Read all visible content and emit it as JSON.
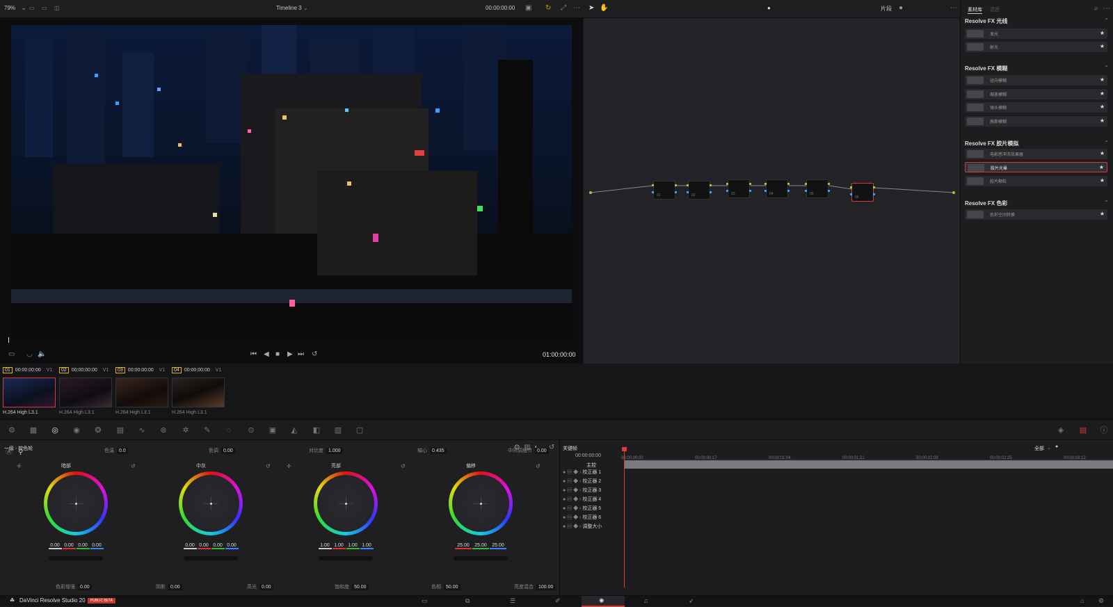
{
  "topbar": {
    "zoom": "79%",
    "timeline_name": "Timeline 3",
    "timecode": "00:00:00:00",
    "mode_label": "片段",
    "library_tab": "素材库",
    "library_tab2": "混音"
  },
  "viewer": {
    "timecode": "01:00:00:00"
  },
  "library": {
    "sections": [
      {
        "title": "Resolve FX 光线",
        "items": [
          "发光",
          "射光"
        ]
      },
      {
        "title": "Resolve FX 模糊",
        "items": [
          "径向模糊",
          "缩放模糊",
          "镜头模糊",
          "高斯模糊"
        ]
      },
      {
        "title": "Resolve FX 胶片模拟",
        "items": [
          "电影感冲洗效果器",
          "胶片光晕",
          "胶片颗粒"
        ]
      },
      {
        "title": "Resolve FX 色彩",
        "items": [
          "色彩空间转换"
        ]
      }
    ],
    "selected_item": "胶片光晕"
  },
  "nodes": [
    {
      "label": "01"
    },
    {
      "label": "02"
    },
    {
      "label": "03"
    },
    {
      "label": "04"
    },
    {
      "label": "05"
    },
    {
      "label": "06"
    }
  ],
  "clips": [
    {
      "num": "01",
      "timecode": "00:00:00:00",
      "track": "V1",
      "name": "H.264 High L3.1"
    },
    {
      "num": "02",
      "timecode": "00:00:00:00",
      "track": "V1",
      "name": "H.264 High L3.1"
    },
    {
      "num": "03",
      "timecode": "00:00:00:00",
      "track": "V1",
      "name": "H.264 High L3.1"
    },
    {
      "num": "04",
      "timecode": "00:00:00:00",
      "track": "V1",
      "name": "H.264 High L3.1"
    }
  ],
  "primaries": {
    "title": "一级 - 校色轮",
    "params_top": [
      {
        "label": "色温",
        "value": "0.0"
      },
      {
        "label": "色调",
        "value": "0.00"
      },
      {
        "label": "对比度",
        "value": "1.000"
      },
      {
        "label": "轴心",
        "value": "0.435"
      },
      {
        "label": "中间调细节",
        "value": "0.00"
      }
    ],
    "wheels": [
      {
        "title": "暗部",
        "values": [
          "0.00",
          "0.00",
          "0.00",
          "0.00"
        ]
      },
      {
        "title": "中灰",
        "values": [
          "0.00",
          "0.00",
          "0.00",
          "0.00"
        ]
      },
      {
        "title": "亮部",
        "values": [
          "1.00",
          "1.00",
          "1.00",
          "1.00"
        ]
      },
      {
        "title": "偏移",
        "values": [
          "25.00",
          "25.00",
          "25.00"
        ]
      }
    ],
    "params_bottom": [
      {
        "label": "色彩增强",
        "value": "0.00"
      },
      {
        "label": "阴影",
        "value": "0.00"
      },
      {
        "label": "高光",
        "value": "0.00"
      },
      {
        "label": "饱和度",
        "value": "50.00"
      },
      {
        "label": "色相",
        "value": "50.00"
      },
      {
        "label": "亮度混合",
        "value": "100.00"
      }
    ]
  },
  "keyframes": {
    "title": "关键帧",
    "filter": "全部",
    "timecode": "00:00:00:00",
    "ruler": [
      "00:00:00:00",
      "00:00:00:17",
      "00:00:01:04",
      "00:00:01:21",
      "00:00:02:08",
      "00:00:02:25",
      "00:00:03:12"
    ],
    "master": "主控",
    "rows": [
      "校正器 1",
      "校正器 2",
      "校正器 3",
      "校正器 4",
      "校正器 5",
      "校正器 6",
      "调整大小"
    ]
  },
  "footer": {
    "app_name": "DaVinci Resolve Studio 20",
    "badge": "PUBLIC BETA"
  },
  "colors": {
    "accent_red": "#d13d3d",
    "node_green": "#9acd32",
    "node_blue": "#3aa0ff"
  }
}
